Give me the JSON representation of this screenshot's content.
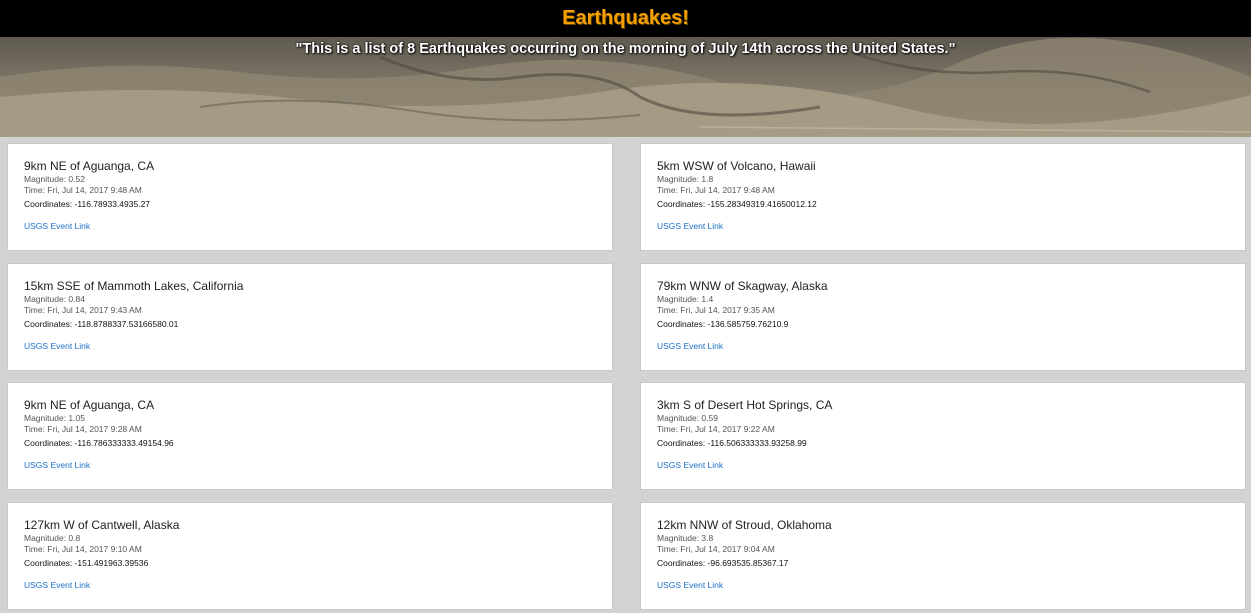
{
  "header": {
    "title": "Earthquakes!"
  },
  "banner": {
    "subtitle": "\"This is a list of 8 Earthquakes occurring on the morning of July 14th across the United States.\""
  },
  "labels": {
    "magnitude_prefix": "Magnitude: ",
    "time_prefix": "Time: ",
    "coords_prefix": "Coordinates: ",
    "link_text": "USGS Event Link"
  },
  "quakes": [
    {
      "place": "9km NE of Aguanga, CA",
      "magnitude": "Magnitude: 0.52",
      "time": "Time: Fri, Jul 14, 2017 9:48 AM",
      "coords": "Coordinates: -116.78933.4935.27",
      "link": "USGS Event Link"
    },
    {
      "place": "5km WSW of Volcano, Hawaii",
      "magnitude": "Magnitude: 1.8",
      "time": "Time: Fri, Jul 14, 2017 9:48 AM",
      "coords": "Coordinates: -155.28349319.41650012.12",
      "link": "USGS Event Link"
    },
    {
      "place": "15km SSE of Mammoth Lakes, California",
      "magnitude": "Magnitude: 0.84",
      "time": "Time: Fri, Jul 14, 2017 9:43 AM",
      "coords": "Coordinates: -118.8788337.53166580.01",
      "link": "USGS Event Link"
    },
    {
      "place": "79km WNW of Skagway, Alaska",
      "magnitude": "Magnitude: 1.4",
      "time": "Time: Fri, Jul 14, 2017 9:35 AM",
      "coords": "Coordinates: -136.585759.76210.9",
      "link": "USGS Event Link"
    },
    {
      "place": "9km NE of Aguanga, CA",
      "magnitude": "Magnitude: 1.05",
      "time": "Time: Fri, Jul 14, 2017 9:28 AM",
      "coords": "Coordinates: -116.786333333.49154.96",
      "link": "USGS Event Link"
    },
    {
      "place": "3km S of Desert Hot Springs, CA",
      "magnitude": "Magnitude: 0.59",
      "time": "Time: Fri, Jul 14, 2017 9:22 AM",
      "coords": "Coordinates: -116.506333333.93258.99",
      "link": "USGS Event Link"
    },
    {
      "place": "127km W of Cantwell, Alaska",
      "magnitude": "Magnitude: 0.8",
      "time": "Time: Fri, Jul 14, 2017 9:10 AM",
      "coords": "Coordinates: -151.491963.39536",
      "link": "USGS Event Link"
    },
    {
      "place": "12km NNW of Stroud, Oklahoma",
      "magnitude": "Magnitude: 3.8",
      "time": "Time: Fri, Jul 14, 2017 9:04 AM",
      "coords": "Coordinates: -96.693535.85367.17",
      "link": "USGS Event Link"
    }
  ],
  "colors": {
    "title": "#f5a000",
    "header_bg": "#000000",
    "page_bg": "#d3d3d3",
    "link": "#1b6fc9"
  }
}
